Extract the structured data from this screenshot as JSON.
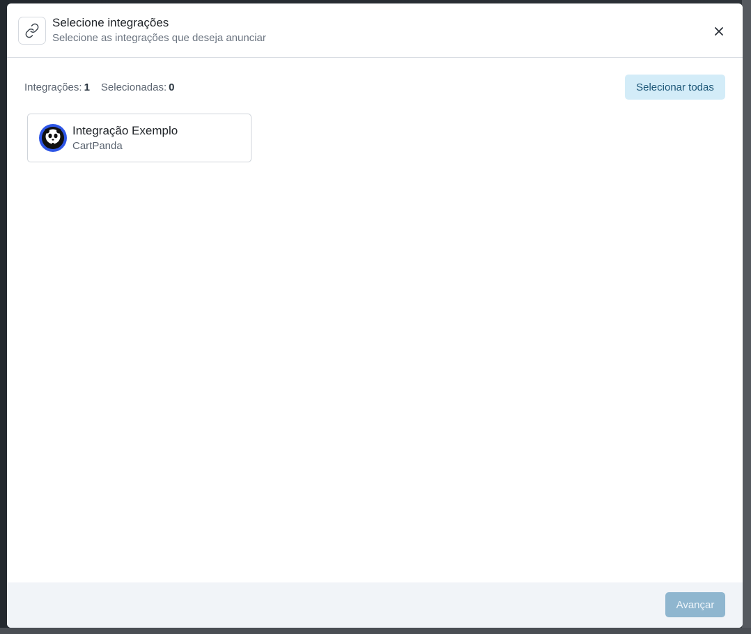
{
  "header": {
    "title": "Selecione integrações",
    "subtitle": "Selecione as integrações que deseja anunciar",
    "icon": "link-icon",
    "close_icon": "close-icon"
  },
  "counts": {
    "integrations_label": "Integrações:",
    "integrations_value": "1",
    "selected_label": "Selecionadas:",
    "selected_value": "0"
  },
  "actions": {
    "select_all_label": "Selecionar todas",
    "next_label": "Avançar"
  },
  "integrations": [
    {
      "name": "Integração Exemplo",
      "provider": "CartPanda",
      "logo": "panda-logo-icon",
      "logo_color": "#2e56e6"
    }
  ],
  "colors": {
    "primary_light": "#d3ecf8",
    "primary_text": "#1d5778",
    "disabled_button": "#8fb6cf"
  }
}
